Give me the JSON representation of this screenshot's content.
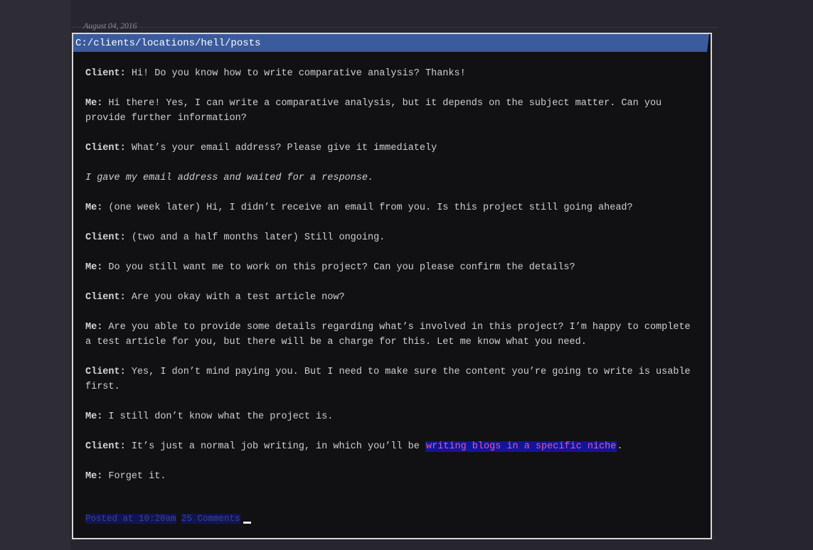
{
  "post": {
    "date": "August 04, 2016",
    "path": "C:/clients/locations/hell/posts",
    "lines": [
      {
        "speaker": "Client:",
        "text": " Hi! Do you know how to write comparative analysis? Thanks!"
      },
      {
        "speaker": "Me:",
        "text": " Hi there! Yes, I can write a comparative analysis, but it depends on the subject matter. Can you provide further information?"
      },
      {
        "speaker": "Client:",
        "text": " What’s your email address? Please give it immediately"
      },
      {
        "note": "I gave my email address and waited for a response."
      },
      {
        "speaker": "Me:",
        "text": " (one week later) Hi, I didn’t receive an email from you. Is this project still going ahead?"
      },
      {
        "speaker": "Client:",
        "text": " (two and a half months later) Still ongoing."
      },
      {
        "speaker": "Me:",
        "text": " Do you still want me to work on this project? Can you please confirm the details?"
      },
      {
        "speaker": "Client:",
        "text": " Are you okay with a test article now?"
      },
      {
        "speaker": "Me:",
        "text": " Are you able to provide some details regarding what’s involved in this project? I’m happy to complete a test article for you, but there will be a charge for this. Let me know what you need."
      },
      {
        "speaker": "Client:",
        "text": " Yes, I don’t mind paying you. But I need to make sure the content you’re going to write is usable first."
      },
      {
        "speaker": "Me:",
        "text": " I still don’t know what the project is."
      },
      {
        "speaker": "Client:",
        "text_before": " It’s just a normal job writing, in which you’ll be ",
        "highlight": "writing blogs in a specific niche",
        "text_after": "."
      },
      {
        "speaker": "Me:",
        "text": " Forget it."
      }
    ],
    "footer": {
      "posted": "Posted at 10:20am",
      "comments": "25 Comments"
    }
  },
  "colors": {
    "page_background": "#27252f",
    "window_background": "#111113",
    "titlebar": "#3a5b9c",
    "body_text": "#cfcfcf",
    "highlight_background": "#12149c",
    "highlight_text": "#e15aa0",
    "footer_chip_background": "#101550",
    "footer_chip_text": "#3a4492"
  }
}
